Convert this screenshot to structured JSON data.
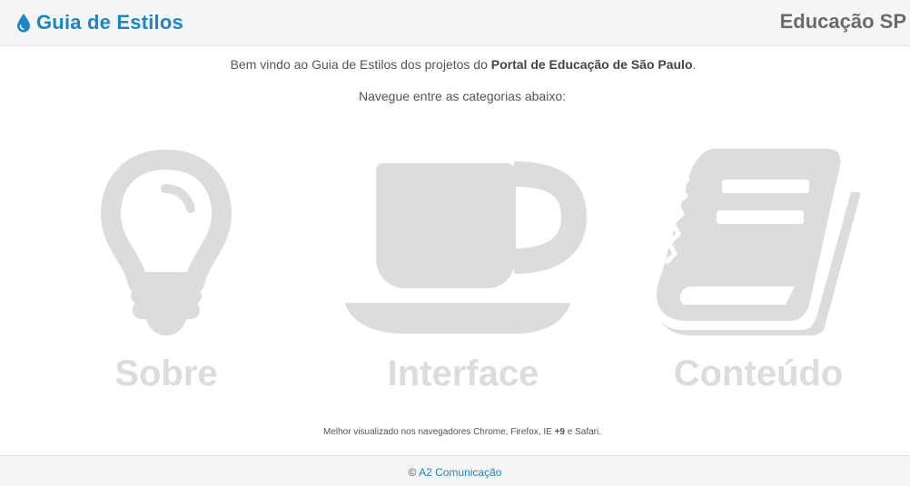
{
  "header": {
    "brand_title": "Guia de Estilos",
    "brand_icon": "drop-icon",
    "site_name": "Educação SP"
  },
  "intro": {
    "prefix": "Bem vindo ao Guia de Estilos dos projetos do ",
    "highlight": "Portal de Educação de São Paulo",
    "suffix": "."
  },
  "nav_hint": "Navegue entre as categorias abaixo:",
  "categories": [
    {
      "label": "Sobre",
      "icon": "lightbulb-icon"
    },
    {
      "label": "Interface",
      "icon": "coffee-cup-icon"
    },
    {
      "label": "Conteúdo",
      "icon": "book-icon"
    }
  ],
  "browsers_note": {
    "prefix": "Melhor visualizado nos navegadores Chrome, Firefox, IE ",
    "highlight": "+9",
    "suffix": " e Safari."
  },
  "footer": {
    "copyright_symbol": "©",
    "link_text": "A2 Comunicação"
  },
  "colors": {
    "accent": "#1a86c7",
    "icon_gray": "#dcdcdc",
    "bar_background": "#f5f5f5"
  }
}
